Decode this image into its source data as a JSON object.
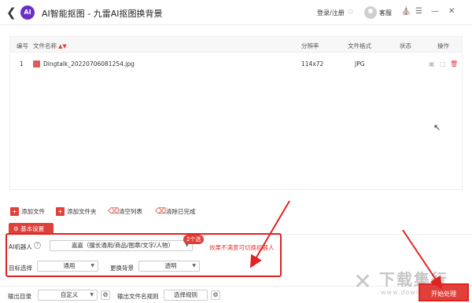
{
  "titlebar": {
    "title": "AI智能抠图 - 九雷AI抠图换背景",
    "login": "登录/注册",
    "service": "客服",
    "icons": [
      "back-arrow",
      "diamond",
      "avatar",
      "shirt",
      "menu",
      "minimize",
      "close"
    ]
  },
  "table": {
    "columns": [
      "编号",
      "文件名称",
      "分辨率",
      "文件格式",
      "状态",
      "操作"
    ],
    "rows": [
      {
        "index": "1",
        "name": "Dingtalk_20220706081254.jpg",
        "resolution": "114x72",
        "format": "JPG",
        "status": ""
      }
    ]
  },
  "toolbar": {
    "add_file": "添加文件",
    "add_folder": "添加文件夹",
    "clear_list": "清空列表",
    "clear_done": "清除已完成"
  },
  "settings": {
    "tab": "基本设置",
    "ai_robot_label": "AI机器人",
    "ai_robot_value": "嘉嘉（擅长通用/商品/图章/文字/人物）",
    "count_badge": "2个选",
    "hint": "效果不满意可切换机器人",
    "target_label": "目标选择",
    "target_value": "通用",
    "bg_label": "更换背景",
    "bg_value": "透明"
  },
  "bottom": {
    "output_dir_label": "输出目录",
    "output_dir_value": "自定义",
    "filename_rule_label": "输出文件名规则",
    "filename_rule_button": "选择规则",
    "start_button": "开始处理"
  },
  "watermark": {
    "main": "下载集行",
    "sub": "www.downxia.com"
  },
  "colors": {
    "accent": "#e0403a",
    "annotation": "#e02222",
    "logo": "#6a2fc4"
  }
}
